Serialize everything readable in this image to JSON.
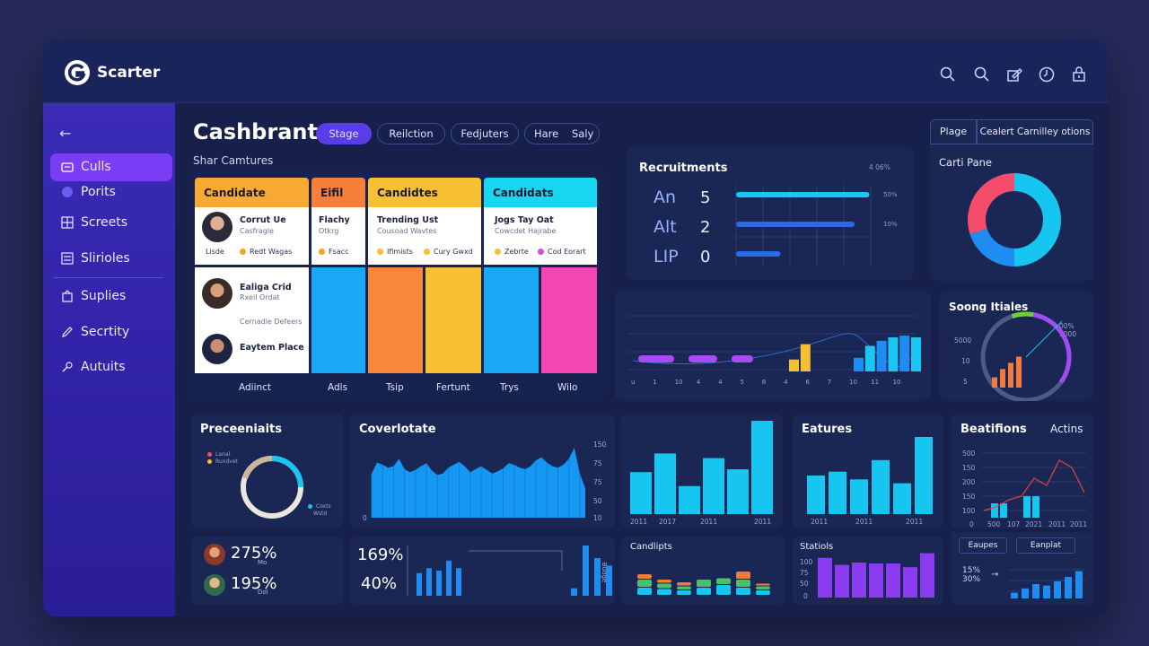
{
  "app": {
    "brand": "Scarter"
  },
  "sidebar": {
    "items": [
      {
        "label": "Culls",
        "icon": "folder-icon",
        "active": true
      },
      {
        "label": "Porits",
        "icon": "circle-icon"
      },
      {
        "label": "Screets",
        "icon": "grid-icon"
      },
      {
        "label": "Slirioles",
        "icon": "list-icon"
      },
      {
        "label": "Suplies",
        "icon": "supplies-icon"
      },
      {
        "label": "Secrtity",
        "icon": "pen-icon"
      },
      {
        "label": "Autuits",
        "icon": "wrench-icon"
      }
    ]
  },
  "header": {
    "title": "Cashbrant",
    "subtitle": "Shar Camtures",
    "pills": [
      {
        "label": "Stage",
        "active": true
      },
      {
        "label": "Reilction"
      },
      {
        "label": "Fedjuters"
      },
      {
        "label": "Hare"
      },
      {
        "label": "Saly"
      }
    ]
  },
  "kanban": {
    "columns": [
      {
        "title": "Candidate",
        "color": "#f7a932",
        "footer": "Adiinct",
        "f2": ""
      },
      {
        "title": "Eifil",
        "color": "#f77f3a",
        "footer": "Adls",
        "f2": ""
      },
      {
        "title": "Candidtes",
        "color": "#f7c034",
        "footer": "Tsip",
        "f2": "Fertunt"
      },
      {
        "title": "Candidats",
        "color": "#17d6f2",
        "footer": "Trys",
        "f2": "Wilo"
      }
    ],
    "card1": {
      "name": "Corrut Ue",
      "sub": "Casfragle",
      "t1": "Lisde",
      "t2": "Redt Wagas"
    },
    "card2": {
      "name": "Flachy",
      "sub": "Otkrg",
      "t1": "Fsacc"
    },
    "card3": {
      "name": "Trending Ust",
      "sub": "Cousoad Wavtes",
      "t1": "Ifimists",
      "t2": "Cury Gwxd"
    },
    "card4": {
      "name": "Jogs Tay Oat",
      "sub": "Cowcdet Hajrabe",
      "t1": "Zebrte",
      "t2": "Cod Eorart"
    },
    "card5": {
      "name": "Ealiga Crid",
      "sub": "Rxeil Ordat",
      "t1": "Cernadle Defeers",
      "name2": "Eaytem Place"
    }
  },
  "recruitments": {
    "title": "Recruitments",
    "header_value": "4 06%",
    "rows": [
      {
        "label": "An",
        "value": "5",
        "fill": 0.9,
        "color": "#19c8f2",
        "tag": "50%"
      },
      {
        "label": "Alt",
        "value": "2",
        "fill": 0.8,
        "color": "#2b69e8",
        "tag": "10%"
      },
      {
        "label": "LIP",
        "value": "0",
        "fill": 0.3,
        "color": "#2b69e8",
        "tag": ""
      }
    ]
  },
  "top_right": {
    "tabs": [
      "Plage",
      "Cealert Carnilley otions"
    ],
    "donut_title": "Carti Pane",
    "donut": [
      {
        "value": 0.5,
        "color": "#17c6f0"
      },
      {
        "value": 0.2,
        "color": "#1e8cf0"
      },
      {
        "value": 0.3,
        "color": "#f34d6b"
      }
    ]
  },
  "timeline": {
    "x_labels": [
      "u",
      "1",
      "10",
      "4",
      "4",
      "5",
      "8",
      "4",
      "6",
      "7",
      "10",
      "11",
      "10"
    ],
    "segments": [
      {
        "x0": 0.5,
        "x1": 3.0,
        "color": "#a64df5"
      },
      {
        "x0": 4.0,
        "x1": 6.0,
        "color": "#a64df5"
      },
      {
        "x0": 7.0,
        "x1": 8.5,
        "color": "#a64df5"
      }
    ],
    "bars": [
      {
        "x": 11.0,
        "v": 0.35,
        "color": "#f5c034"
      },
      {
        "x": 11.8,
        "v": 0.8,
        "color": "#f5c034"
      },
      {
        "x": 15.5,
        "v": 0.4,
        "color": "#1e8cf0"
      },
      {
        "x": 16.3,
        "v": 0.75,
        "color": "#19c8f2"
      },
      {
        "x": 17.1,
        "v": 0.9,
        "color": "#1e8cf0"
      },
      {
        "x": 17.9,
        "v": 1.0,
        "color": "#19c8f2"
      },
      {
        "x": 18.7,
        "v": 1.05,
        "color": "#1e8cf0"
      },
      {
        "x": 19.5,
        "v": 1.0,
        "color": "#19c8f2"
      }
    ]
  },
  "sourcing": {
    "title": "Soong Itiales",
    "y_labels": [
      "5000",
      "10",
      "5"
    ],
    "right_labels": [
      "00%",
      "5000"
    ],
    "bars": [
      0.25,
      0.45,
      0.6,
      0.75
    ],
    "gauge": 0.7
  },
  "percentiles": {
    "title": "Preceeniaits",
    "legend": [
      {
        "label": "Lanal",
        "color": "#f34d6b"
      },
      {
        "label": "Rundvet",
        "color": "#f5c034"
      }
    ],
    "legend2": [
      {
        "label": "Coxts",
        "color": "#17c6f0"
      },
      {
        "label": "Wstd",
        "color": ""
      }
    ]
  },
  "coverage": {
    "title": "Coverlotate",
    "y_labels": [
      "150",
      "75",
      "75",
      "50",
      "10"
    ],
    "x0": "0",
    "values": [
      60,
      75,
      72,
      68,
      70,
      80,
      66,
      62,
      65,
      70,
      74,
      64,
      58,
      60,
      68,
      72,
      76,
      70,
      62,
      66,
      70,
      65,
      60,
      63,
      67,
      74,
      72,
      68,
      66,
      70,
      78,
      82,
      75,
      70,
      68,
      72,
      80,
      95,
      60,
      40
    ]
  },
  "years_chart": {
    "x_labels": [
      "2011",
      "2017",
      "2011",
      "2011"
    ],
    "values": [
      0.45,
      0.65,
      0.3,
      0.6,
      0.48,
      1.0
    ]
  },
  "features": {
    "title": "Eatures",
    "x_labels": [
      "2011",
      "2011",
      "2011"
    ],
    "values": [
      0.5,
      0.55,
      0.45,
      0.7,
      0.4,
      1.0
    ]
  },
  "positions": {
    "title": "Beatifions",
    "action": "Actins",
    "y_labels": [
      "500",
      "150",
      "200",
      "150",
      "100",
      "0"
    ],
    "x_labels": [
      "500",
      "107",
      "2021",
      "2011",
      "2011"
    ],
    "bars": [
      0.2,
      0.2,
      0.3,
      0.3
    ],
    "line": [
      0.1,
      0.15,
      0.25,
      0.3,
      0.55,
      0.45,
      0.8,
      0.7,
      0.35
    ]
  },
  "stats_avatars": {
    "rows": [
      {
        "value": "275%",
        "suffix": "Mo"
      },
      {
        "value": "195%",
        "suffix": "Dol"
      }
    ]
  },
  "stats_mid": {
    "v1": "169%",
    "v2": "40%",
    "bars1": [
      0.45,
      0.55,
      0.5,
      0.7,
      0.55
    ],
    "bars2": [
      0.15,
      1.0,
      0.75,
      0.6,
      0.5
    ],
    "side": "Budge"
  },
  "candidates_chart": {
    "title": "Candlipts",
    "stacks": [
      [
        0.3,
        0.3,
        0.2
      ],
      [
        0.25,
        0.2,
        0.15
      ],
      [
        0.2,
        0.15,
        0.15
      ],
      [
        0.3,
        0.3
      ],
      [
        0.4,
        0.25
      ],
      [
        0.3,
        0.3,
        0.3
      ],
      [
        0.2,
        0.15,
        0.1
      ]
    ]
  },
  "statins": {
    "title": "Statiols",
    "y_labels": [
      "100",
      "75",
      "50",
      "0"
    ],
    "values": [
      0.85,
      0.7,
      0.75,
      0.73,
      0.73,
      0.65,
      0.95
    ]
  },
  "mini": {
    "tabs": [
      "Eaupes",
      "Eanplat"
    ],
    "left": "15% 30%",
    "values": [
      0.2,
      0.35,
      0.5,
      0.45,
      0.6,
      0.75,
      0.95
    ]
  }
}
